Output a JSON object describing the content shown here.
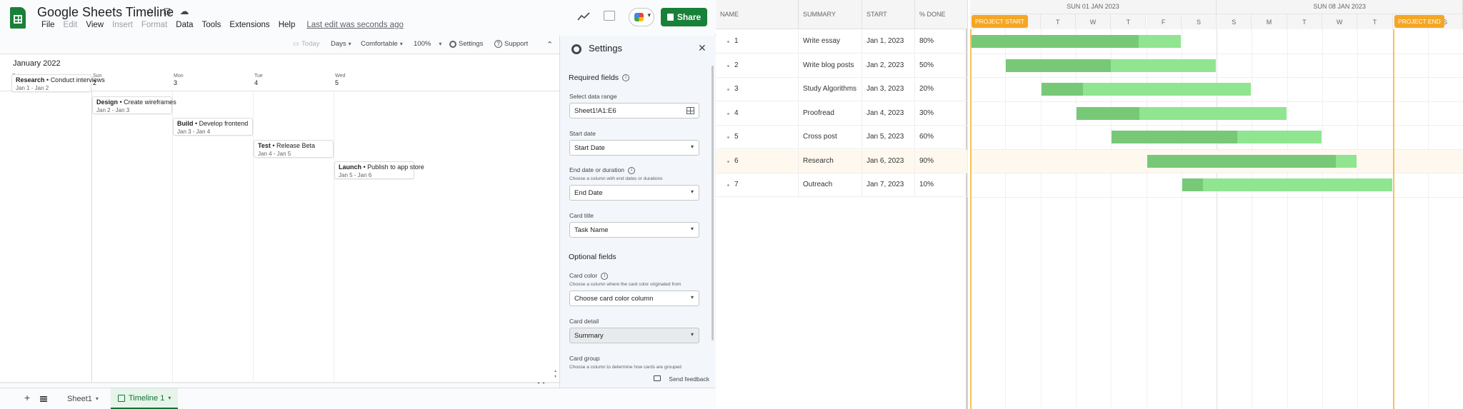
{
  "app": {
    "title": "Google Sheets Timeline",
    "menus": [
      "File",
      "Edit",
      "View",
      "Insert",
      "Format",
      "Data",
      "Tools",
      "Extensions",
      "Help"
    ],
    "disabled_menus": [
      "Edit",
      "Insert",
      "Format"
    ],
    "last_edit": "Last edit was seconds ago",
    "share_label": "Share",
    "accent": "#188038"
  },
  "toolbar": {
    "today": "Today",
    "days": "Days",
    "density": "Comfortable",
    "zoom": "100%",
    "settings": "Settings",
    "support": "Support"
  },
  "timeline": {
    "month": "January 2022",
    "days": [
      {
        "dow": "Sat",
        "num": "1"
      },
      {
        "dow": "Sun",
        "num": "2"
      },
      {
        "dow": "Mon",
        "num": "3"
      },
      {
        "dow": "Tue",
        "num": "4"
      },
      {
        "dow": "Wed",
        "num": "5"
      }
    ],
    "cards": [
      {
        "group": "Research",
        "task": "Conduct interviews",
        "dates": "Jan 1 - Jan 2"
      },
      {
        "group": "Design",
        "task": "Create wireframes",
        "dates": "Jan 2 - Jan 3"
      },
      {
        "group": "Build",
        "task": "Develop frontend",
        "dates": "Jan 3 - Jan 4"
      },
      {
        "group": "Test",
        "task": "Release Beta",
        "dates": "Jan 4 - Jan 5"
      },
      {
        "group": "Launch",
        "task": "Publish to app store",
        "dates": "Jan 5 - Jan 6"
      }
    ]
  },
  "settings": {
    "title": "Settings",
    "required": "Required fields",
    "range_label": "Select data range",
    "range_value": "Sheet1!A1:E6",
    "start_label": "Start date",
    "start_value": "Start Date",
    "end_label": "End date or duration",
    "end_help": "Choose a column with end dates or durations",
    "end_value": "End Date",
    "card_title_label": "Card title",
    "card_title_value": "Task Name",
    "optional": "Optional fields",
    "color_label": "Card color",
    "color_help": "Choose a column where the card color originated from",
    "color_value": "Choose card color column",
    "detail_label": "Card detail",
    "detail_value": "Summary",
    "group_label": "Card group",
    "group_help": "Choose a column to determine how cards are grouped",
    "feedback": "Send feedback"
  },
  "sheets": {
    "tabs": [
      "Sheet1",
      "Timeline 1"
    ],
    "active": "Timeline 1"
  },
  "gantt": {
    "columns": [
      "NAME",
      "SUMMARY",
      "START",
      "% DONE"
    ],
    "rows": [
      {
        "name": "1",
        "summary": "Write essay",
        "start": "Jan 1, 2023",
        "done": "80%",
        "pct": 0.8
      },
      {
        "name": "2",
        "summary": "Write blog posts",
        "start": "Jan 2, 2023",
        "done": "50%",
        "pct": 0.5
      },
      {
        "name": "3",
        "summary": "Study Algorithms",
        "start": "Jan 3, 2023",
        "done": "20%",
        "pct": 0.2
      },
      {
        "name": "4",
        "summary": "Proofread",
        "start": "Jan 4, 2023",
        "done": "30%",
        "pct": 0.3
      },
      {
        "name": "5",
        "summary": "Cross post",
        "start": "Jan 5, 2023",
        "done": "60%",
        "pct": 0.6
      },
      {
        "name": "6",
        "summary": "Research",
        "start": "Jan 6, 2023",
        "done": "90%",
        "pct": 0.9
      },
      {
        "name": "7",
        "summary": "Outreach",
        "start": "Jan 7, 2023",
        "done": "10%",
        "pct": 0.1
      }
    ],
    "highlight_row": "6",
    "weeks": [
      "SUN 01 JAN 2023",
      "SUN 08 JAN 2023"
    ],
    "day_letters": [
      "S",
      "M",
      "T",
      "W",
      "T",
      "F",
      "S",
      "S",
      "M",
      "T",
      "W",
      "T",
      "F",
      "S"
    ],
    "project_start": "PROJECT START",
    "project_end": "PROJECT END",
    "bar_color": "#90e590",
    "done_color": "#77c977",
    "marker_color": "#f5a623"
  }
}
